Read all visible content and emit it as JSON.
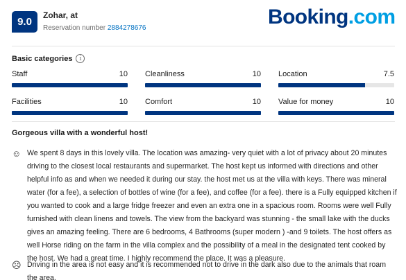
{
  "header": {
    "score": "9.0",
    "reviewer_name": "Zohar, at",
    "reservation_label": "Reservation number",
    "reservation_number": "2884278676",
    "logo_main": "Booking",
    "logo_suffix": ".com"
  },
  "categories": {
    "title": "Basic categories",
    "info_icon": "i",
    "items": [
      {
        "label": "Staff",
        "value": "10",
        "fraction": 1.0
      },
      {
        "label": "Cleanliness",
        "value": "10",
        "fraction": 1.0
      },
      {
        "label": "Location",
        "value": "7.5",
        "fraction": 0.75
      },
      {
        "label": "Facilities",
        "value": "10",
        "fraction": 1.0
      },
      {
        "label": "Comfort",
        "value": "10",
        "fraction": 1.0
      },
      {
        "label": "Value for money",
        "value": "10",
        "fraction": 1.0
      }
    ]
  },
  "review": {
    "title": "Gorgeous villa with a wonderful host!",
    "positive_icon": "☺",
    "positive": "We spent 8 days in this lovely villa. The location was amazing- very quiet with a lot of privacy about 20 minutes driving to the closest local restaurants and supermarket. The host kept us informed with directions and other helpful info as and when we needed it during our stay. the host met us at the villa with keys. There was mineral water (for a fee), a selection of bottles of wine (for a fee), and coffee (for a fee). there is a Fully equipped kitchen if you wanted to cook and a large fridge freezer and even an extra one in a spacious room. Rooms were well Fully furnished with clean linens and towels. The view from the backyard was stunning - the small lake with the ducks gives an amazing feeling. There are 6 bedrooms, 4 Bathrooms (super modern ) -and 9 toilets. The host offers as well Horse riding on the farm in the villa complex and the possibility of a meal in the designated tent cooked by the host. We had a great time. I highly recommend the place. It was a pleasure.",
    "negative_icon": "☹",
    "negative": "Driving in the area is not easy and it is recommended not to drive in the dark also due to the animals that roam the area."
  },
  "colors": {
    "brand": "#003580",
    "accent": "#009fe3",
    "link": "#0071c2"
  }
}
